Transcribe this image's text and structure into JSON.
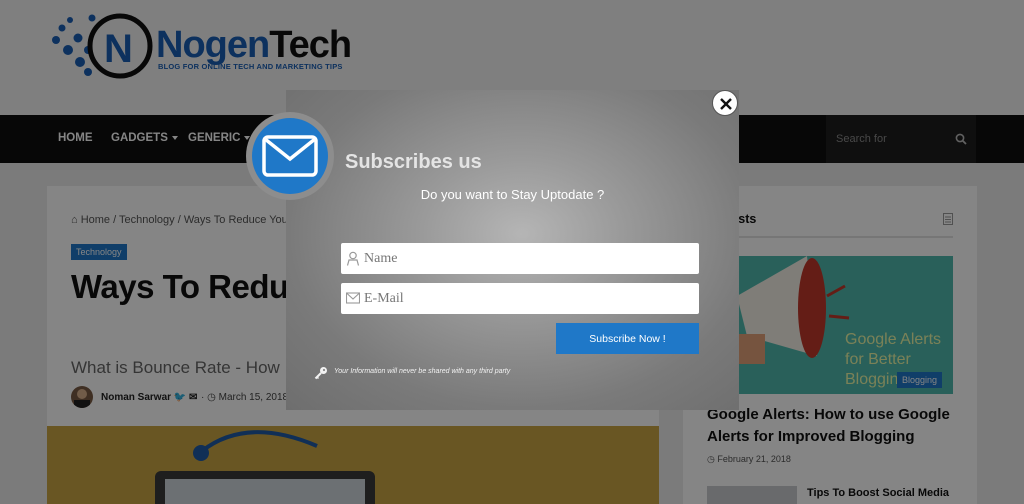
{
  "site": {
    "logo_text_1": "Nogen",
    "logo_text_2": "Tech",
    "tagline": "BLOG FOR ONLINE TECH AND MARKETING TIPS"
  },
  "nav": {
    "items": [
      {
        "label": "HOME",
        "has_caret": false
      },
      {
        "label": "GADGETS",
        "has_caret": true
      },
      {
        "label": "GENERIC",
        "has_caret": true
      }
    ],
    "search_placeholder": "Search for"
  },
  "article": {
    "breadcrumb": "Home / Technology / Ways To Reduce Your",
    "category": "Technology",
    "title": "Ways To Redu and Increase",
    "subtitle": "What is Bounce Rate - How",
    "author": "Noman Sarwar",
    "date": "March 15, 2018"
  },
  "sidebar": {
    "title": "ar Posts",
    "featured_image_text": "Google Alerts for Better Blogging",
    "featured_category": "Blogging",
    "featured_title": "Google Alerts: How to use Google Alerts for Improved Blogging",
    "featured_date": "February 21, 2018",
    "second_title": "Tips To Boost Social Media"
  },
  "popup": {
    "title": "Subscribes us",
    "question": "Do you want to Stay Uptodate ?",
    "name_placeholder": "Name",
    "email_placeholder": "E-Mail",
    "subscribe_label": "Subscribe Now !",
    "privacy_note": "Your Information will never be shared with any third party"
  },
  "colors": {
    "accent": "#1f78c8",
    "nav_bg": "#0f0f0f",
    "overlay": "rgba(0,0,0,0.48)"
  }
}
